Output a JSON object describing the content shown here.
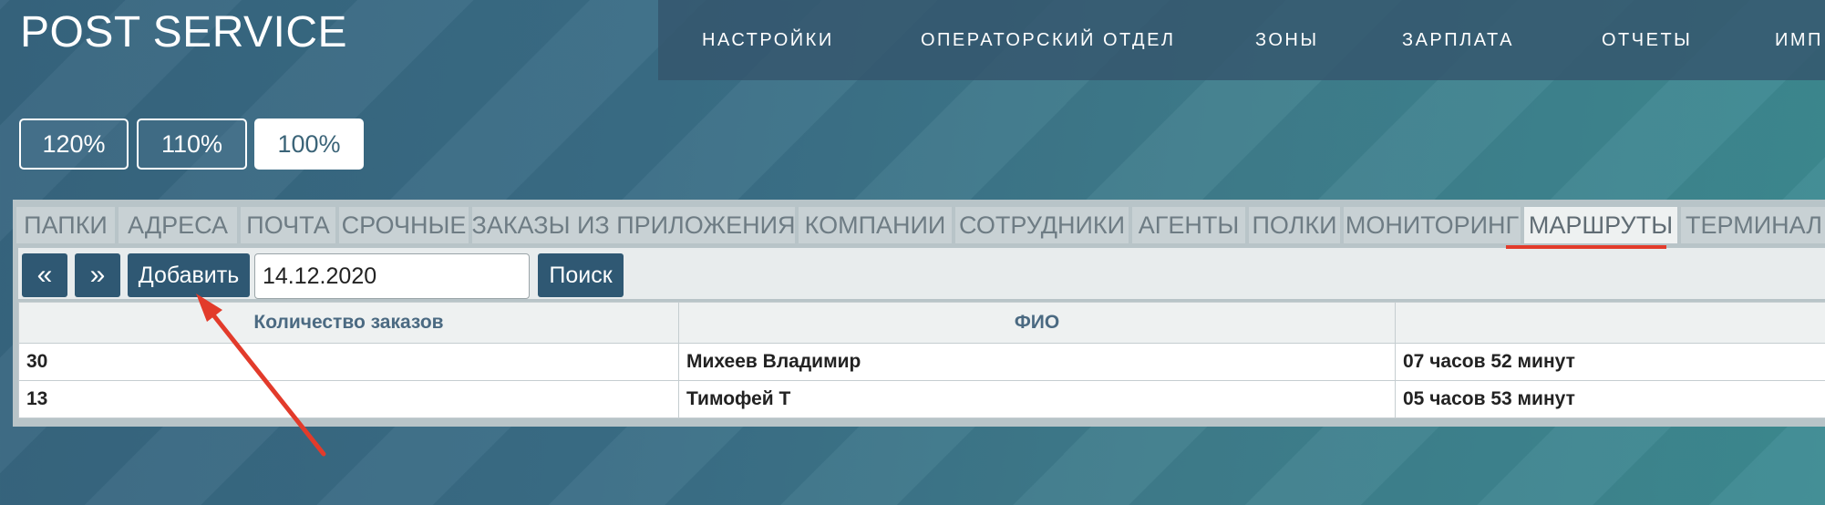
{
  "app": {
    "title": "POST SERVICE"
  },
  "topnav": {
    "items": [
      "НАСТРОЙКИ",
      "ОПЕРАТОРСКИЙ ОТДЕЛ",
      "ЗОНЫ",
      "ЗАРПЛАТА",
      "ОТЧЕТЫ",
      "ИМП"
    ]
  },
  "zoom": {
    "options": [
      "120%",
      "110%",
      "100%"
    ],
    "selected": "100%"
  },
  "tabs": {
    "items": [
      "ПАПКИ",
      "АДРЕСА",
      "ПОЧТА",
      "СРОЧНЫЕ",
      "ЗАКАЗЫ ИЗ ПРИЛОЖЕНИЯ",
      "КОМПАНИИ",
      "СОТРУДНИКИ",
      "АГЕНТЫ",
      "ПОЛКИ",
      "МОНИТОРИНГ",
      "МАРШРУТЫ",
      "ТЕРМИНАЛ"
    ],
    "active": "МАРШРУТЫ"
  },
  "toolbar": {
    "prev_label": "«",
    "next_label": "»",
    "add_label": "Добавить",
    "date_value": "14.12.2020",
    "search_label": "Поиск"
  },
  "table": {
    "headers": [
      "Количество заказов",
      "ФИО",
      ""
    ],
    "rows": [
      [
        "30",
        "Михеев Владимир",
        "07 часов 52 минут"
      ],
      [
        "13",
        "Тимофей Т",
        "05 часов 53 минут"
      ]
    ]
  },
  "colors": {
    "accent": "#2f5873",
    "annotation": "#e23b2b",
    "active_tab_underline": "#e23b2b"
  }
}
